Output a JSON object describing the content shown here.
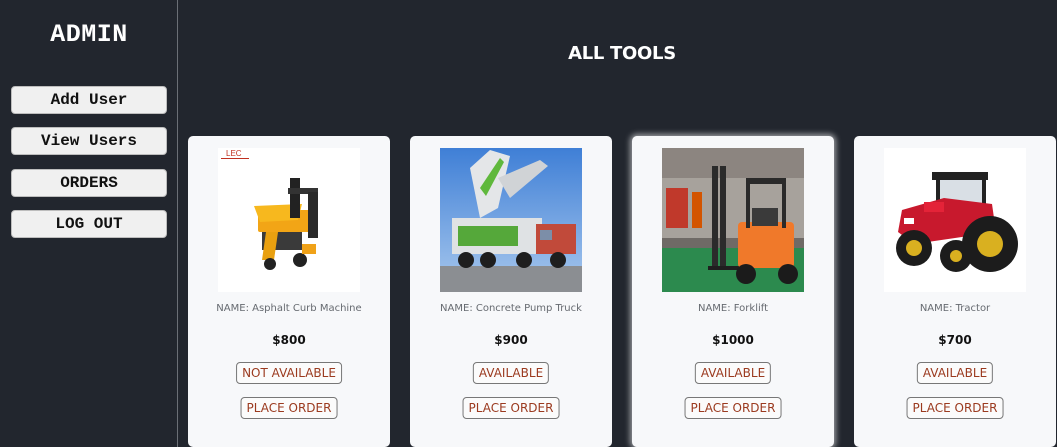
{
  "sidebar": {
    "title": "ADMIN",
    "buttons": [
      "Add User",
      "View Users",
      "ORDERS",
      "LOG OUT"
    ]
  },
  "main": {
    "title": "ALL TOOLS",
    "cards": [
      {
        "name": "NAME: Asphalt Curb Machine",
        "price": "$800",
        "status": "NOT AVAILABLE",
        "order": "PLACE ORDER",
        "logo": "LEC"
      },
      {
        "name": "NAME: Concrete Pump Truck",
        "price": "$900",
        "status": "AVAILABLE",
        "order": "PLACE ORDER"
      },
      {
        "name": "NAME: Forklift",
        "price": "$1000",
        "status": "AVAILABLE",
        "order": "PLACE ORDER"
      },
      {
        "name": "NAME: Tractor",
        "price": "$700",
        "status": "AVAILABLE",
        "order": "PLACE ORDER"
      }
    ]
  },
  "colors": {
    "background": "#22262e",
    "card": "#f7f8fa",
    "button_text": "#9b3a1f"
  }
}
